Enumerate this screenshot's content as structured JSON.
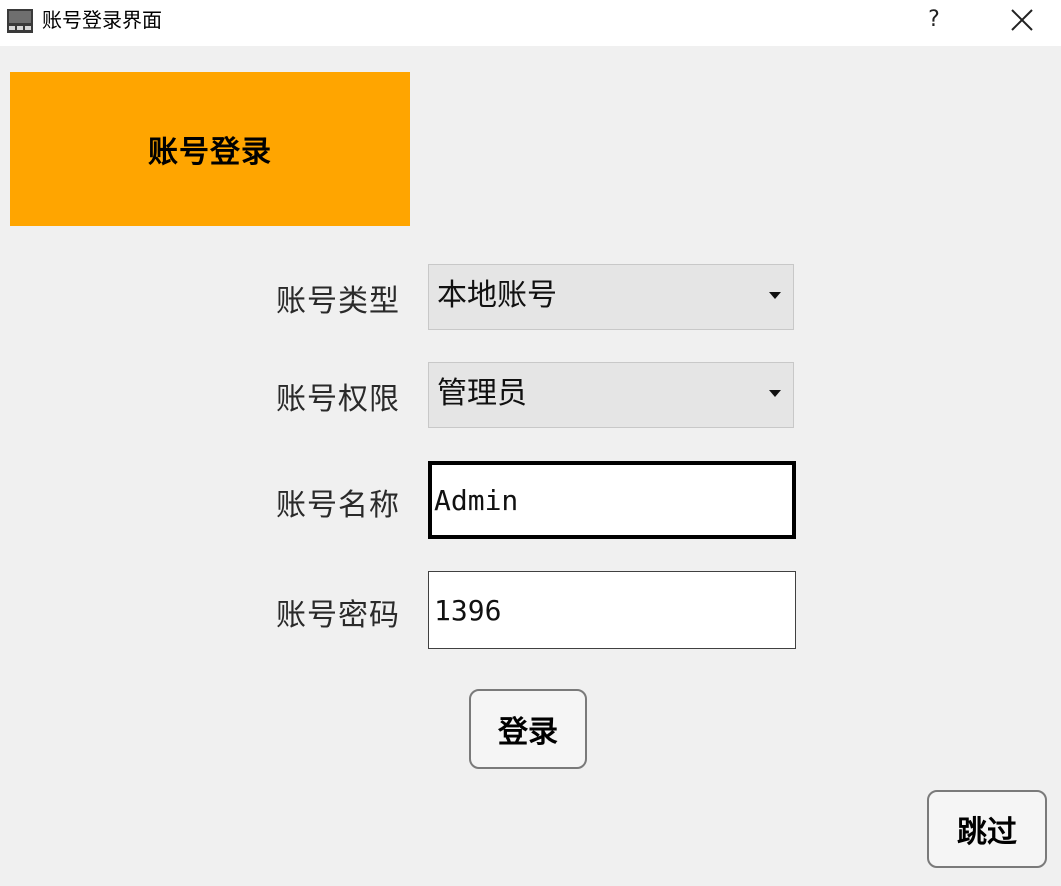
{
  "window": {
    "title": "账号登录界面",
    "help_label": "?",
    "close_icon": "close-icon"
  },
  "banner": {
    "title": "账号登录",
    "color": "#ffa500"
  },
  "form": {
    "account_type": {
      "label": "账号类型",
      "value": "本地账号"
    },
    "account_permission": {
      "label": "账号权限",
      "value": "管理员"
    },
    "account_name": {
      "label": "账号名称",
      "value": "Admin"
    },
    "account_password": {
      "label": "账号密码",
      "value": "1396"
    }
  },
  "actions": {
    "login_label": "登录",
    "skip_label": "跳过"
  }
}
